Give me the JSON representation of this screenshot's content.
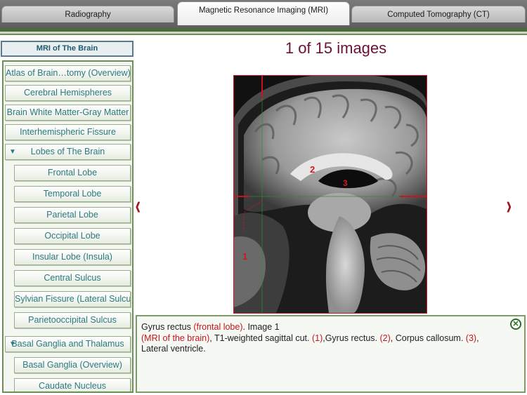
{
  "tabs": [
    {
      "label": "Radiography"
    },
    {
      "label": "Magnetic Resonance Imaging (MRI)"
    },
    {
      "label": "Computed Tomography (CT)"
    }
  ],
  "sidebar": {
    "header": "MRI of The Brain",
    "items": [
      {
        "label": "Atlas of Brain…tomy (Overview)"
      },
      {
        "label": "Cerebral Hemispheres"
      },
      {
        "label": "Brain White Matter-Gray Matter"
      },
      {
        "label": "Interhemispheric Fissure"
      },
      {
        "label": "Lobes of The Brain",
        "expanded": true
      },
      {
        "label": "Frontal Lobe"
      },
      {
        "label": "Temporal Lobe"
      },
      {
        "label": "Parietal Lobe"
      },
      {
        "label": "Occipital Lobe"
      },
      {
        "label": "Insular Lobe (Insula)"
      },
      {
        "label": "Central Sulcus"
      },
      {
        "label": "Sylvian Fissure (Lateral Sulcus)"
      },
      {
        "label": "Parietooccipital Sulcus"
      },
      {
        "label": "Basal Ganglia and Thalamus",
        "expanded": true
      },
      {
        "label": "Basal Ganglia (Overview)"
      },
      {
        "label": "Caudate Nucleus"
      }
    ],
    "expand_icon": "▼"
  },
  "viewer": {
    "counter": "1 of 15 images",
    "markers": [
      "1",
      "2",
      "3"
    ],
    "prev_icon": "‹",
    "next_icon": "›"
  },
  "caption": {
    "part1": "Gyrus rectus ",
    "part2": "(frontal lobe)",
    "part3": ". Image 1",
    "part4": "(MRI of the brain)",
    "part5": ", T1-weighted sagittal cut. ",
    "part6": "(1)",
    "part7": ",Gyrus rectus. ",
    "part8": "(2)",
    "part9": ", Corpus callosum.  ",
    "part10": "(3)",
    "part11": ",",
    "part12": "Lateral ventricle.",
    "close_icon": "✕"
  },
  "colors": {
    "accent_red": "#c4161c",
    "sidebar_text": "#2c7a80",
    "counter": "#6b1236"
  }
}
